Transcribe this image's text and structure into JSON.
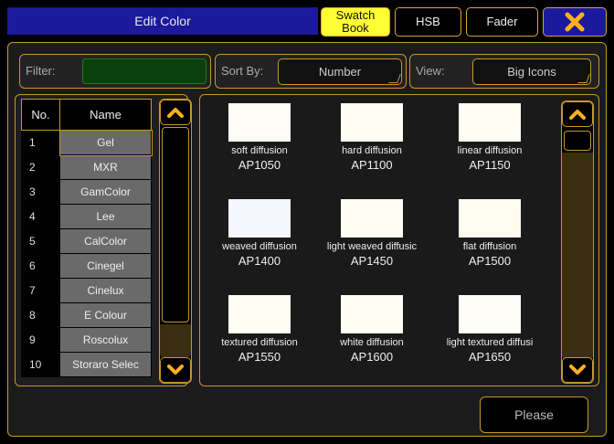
{
  "window": {
    "title": "Edit Color"
  },
  "tabs": [
    {
      "label": "Swatch\nBook",
      "active": true
    },
    {
      "label": "HSB",
      "active": false
    },
    {
      "label": "Fader",
      "active": false
    }
  ],
  "close_icon": "close-x-icon",
  "filter": {
    "label": "Filter:",
    "value": ""
  },
  "sort": {
    "label": "Sort By:",
    "value": "Number"
  },
  "view": {
    "label": "View:",
    "value": "Big Icons"
  },
  "books": {
    "headers": {
      "no": "No.",
      "name": "Name"
    },
    "rows": [
      {
        "no": "1",
        "name": "Gel"
      },
      {
        "no": "2",
        "name": "MXR"
      },
      {
        "no": "3",
        "name": "GamColor"
      },
      {
        "no": "4",
        "name": "Lee"
      },
      {
        "no": "5",
        "name": "CalColor"
      },
      {
        "no": "6",
        "name": "Cinegel"
      },
      {
        "no": "7",
        "name": "Cinelux"
      },
      {
        "no": "8",
        "name": "E Colour"
      },
      {
        "no": "9",
        "name": "Roscolux"
      },
      {
        "no": "10",
        "name": "Storaro Selec"
      }
    ]
  },
  "swatches": [
    {
      "name": "soft diffusion",
      "code": "AP1050",
      "color": "#fdfdf6"
    },
    {
      "name": "hard diffusion",
      "code": "AP1100",
      "color": "#fefef4"
    },
    {
      "name": "linear diffusion",
      "code": "AP1150",
      "color": "#fefef4"
    },
    {
      "name": "weaved diffusion",
      "code": "AP1400",
      "color": "#f6f7fd"
    },
    {
      "name": "light weaved diffusic",
      "code": "AP1450",
      "color": "#fefef4"
    },
    {
      "name": "flat diffusion",
      "code": "AP1500",
      "color": "#fdfcef"
    },
    {
      "name": "textured diffusion",
      "code": "AP1550",
      "color": "#fefef4"
    },
    {
      "name": "white diffusion",
      "code": "AP1600",
      "color": "#fefef4"
    },
    {
      "name": "light textured diffusi",
      "code": "AP1650",
      "color": "#fefef6"
    }
  ],
  "footer": {
    "please_label": "Please"
  },
  "colors": {
    "accent": "#d8a531",
    "title_bg": "#1a1a9a",
    "active_tab": "#ffff33",
    "row_bg": "#6a6a6a"
  }
}
